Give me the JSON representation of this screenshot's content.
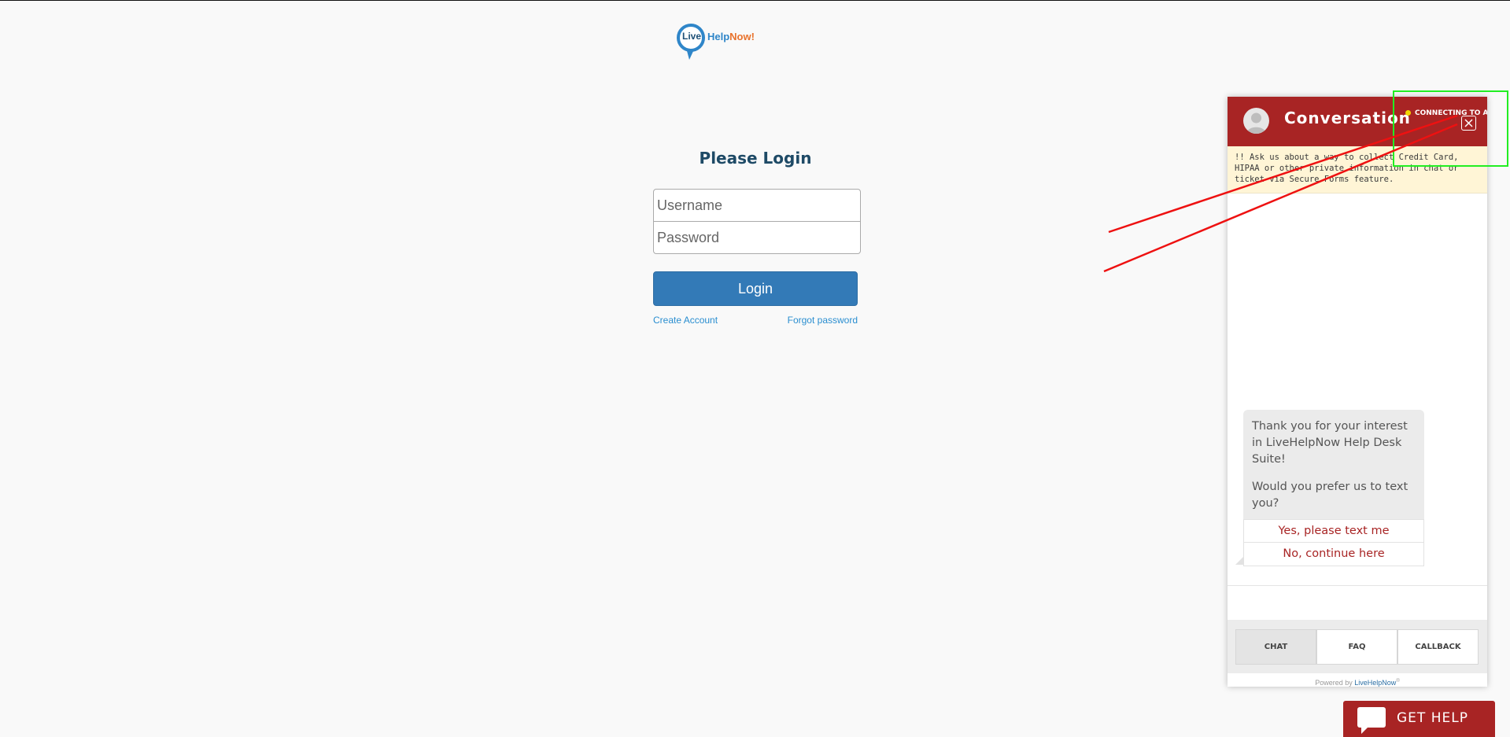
{
  "logo": {
    "live": "Live",
    "help": "Help",
    "now": "Now!"
  },
  "login": {
    "title": "Please Login",
    "username_placeholder": "Username",
    "password_placeholder": "Password",
    "button_label": "Login",
    "create_account": "Create Account",
    "forgot_password": "Forgot password"
  },
  "chat": {
    "title": "Conversation",
    "status": "CONNECTING TO AN",
    "notice": "!! Ask us about a way to collect Credit Card, HIPAA or other private information in chat or ticket via Secure Forms feature.",
    "message_line1": "Thank you for your interest in LiveHelpNow Help Desk Suite!",
    "message_line2": "Would you prefer us to text you?",
    "option_yes": "Yes, please text me",
    "option_no": "No, continue here",
    "tabs": [
      "CHAT",
      "FAQ",
      "CALLBACK"
    ],
    "powered_prefix": "Powered by ",
    "powered_brand": "LiveHelpNow",
    "powered_mark": "®"
  },
  "get_help": {
    "label": "GET HELP"
  },
  "colors": {
    "page_bg": "#f9f9f9",
    "brand_red": "#a82424",
    "login_blue": "#337ab7",
    "link_blue": "#2a8ed0",
    "title_navy": "#1e4a66",
    "annotation_green": "#22ee22",
    "annotation_red": "#ee1111"
  },
  "icons": [
    "logo-bubble-icon",
    "avatar-icon",
    "close-icon",
    "status-dot-icon",
    "chat-bubble-icon"
  ]
}
